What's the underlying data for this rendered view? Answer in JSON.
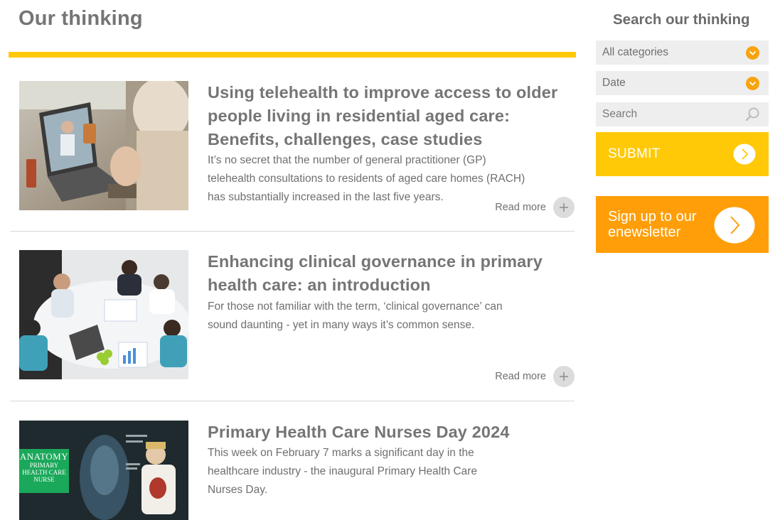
{
  "header": {
    "title": "Our thinking"
  },
  "articles": [
    {
      "title": "Using telehealth to improve access to older people living in residential aged care: Benefits, challenges, case studies",
      "summary": "It’s no secret that the number of general practitioner (GP) telehealth consultations to residents of aged care homes (RACH) has substantially increased in the last five years.",
      "read_more": "Read more",
      "image_icon": "telehealth-photo"
    },
    {
      "title": "Enhancing clinical governance in primary health care: an introduction",
      "summary": "For those not familiar with the term, ‘clinical governance’ can sound daunting - yet in many ways it’s common sense.",
      "read_more": "Read more",
      "image_icon": "meeting-photo"
    },
    {
      "title": "Primary Health Care Nurses Day 2024",
      "summary": "This week on February 7 marks a significant day in the healthcare industry - the inaugural Primary Health Care Nurses Day.",
      "image_icon": "anatomy-poster-photo",
      "image_text": "ANATOMY PRIMARY HEALTH CARE NURSE"
    }
  ],
  "sidebar": {
    "title": "Search our thinking",
    "category_select": "All categories",
    "date_select": "Date",
    "search_placeholder": "Search",
    "submit_label": "SUBMIT",
    "newsletter_label": "Sign up to our enewsletter"
  },
  "colors": {
    "accent_yellow": "#ffc907",
    "accent_orange": "#ff9e08",
    "dropdown_orange": "#f7a40e",
    "text_grey": "#757575",
    "field_grey": "#eeeeee"
  }
}
